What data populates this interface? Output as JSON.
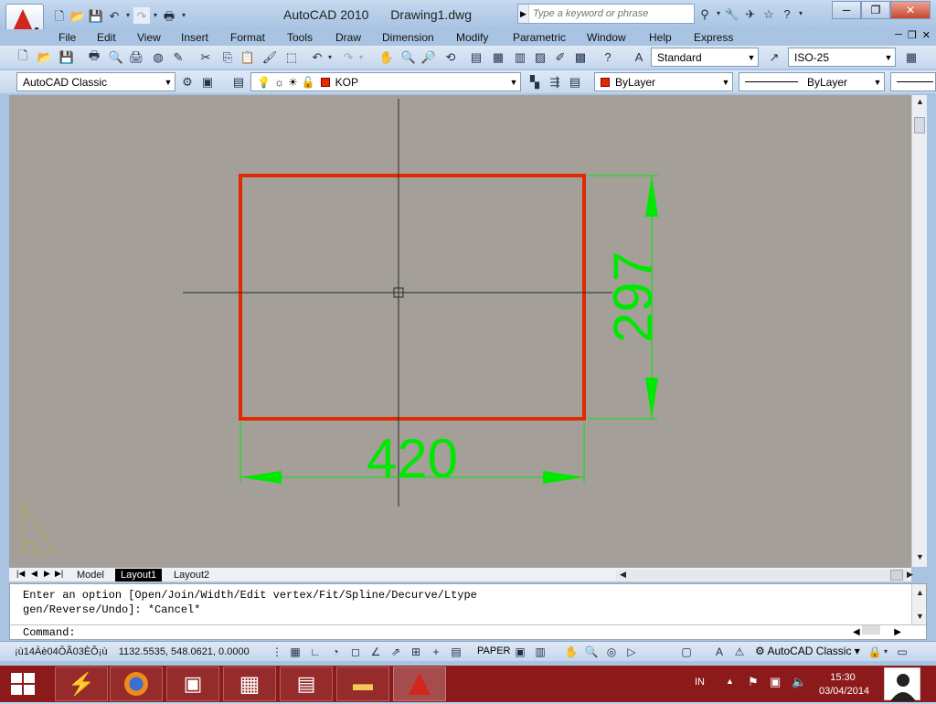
{
  "window": {
    "app_title": "AutoCAD 2010",
    "doc_title": "Drawing1.dwg",
    "search_placeholder": "Type a keyword or phrase"
  },
  "menubar": [
    "File",
    "Edit",
    "View",
    "Insert",
    "Format",
    "Tools",
    "Draw",
    "Dimension",
    "Modify",
    "Parametric",
    "Window",
    "Help",
    "Express"
  ],
  "toolbar": {
    "text_style": "Standard",
    "dim_style": "ISO-25",
    "workspace": "AutoCAD Classic",
    "layer": "KOP",
    "color": "ByLayer",
    "linetype": "ByLayer"
  },
  "drawing": {
    "rect_color": "#e02a00",
    "dim_color": "#00e800",
    "crosshair_color": "#2a2a2a",
    "width_dim": "420",
    "height_dim": "297"
  },
  "layout_tabs": [
    {
      "label": "Model",
      "active": false
    },
    {
      "label": "Layout1",
      "active": true
    },
    {
      "label": "Layout2",
      "active": false
    }
  ],
  "command": {
    "history_line1": "Enter an option [Open/Join/Width/Edit vertex/Fit/Spline/Decurve/Ltype",
    "history_line2": "gen/Reverse/Undo]: *Cancel*",
    "prompt": "Command:"
  },
  "status": {
    "garbled": "¡ù14Äè04ÔÃ03ÈÕ¡ù",
    "coordinates": "1132.5535, 548.0621, 0.0000",
    "paper": "PAPER",
    "workspace": "AutoCAD Classic"
  },
  "taskbar": {
    "lang": "IN",
    "time": "15:30",
    "date": "03/04/2014"
  }
}
